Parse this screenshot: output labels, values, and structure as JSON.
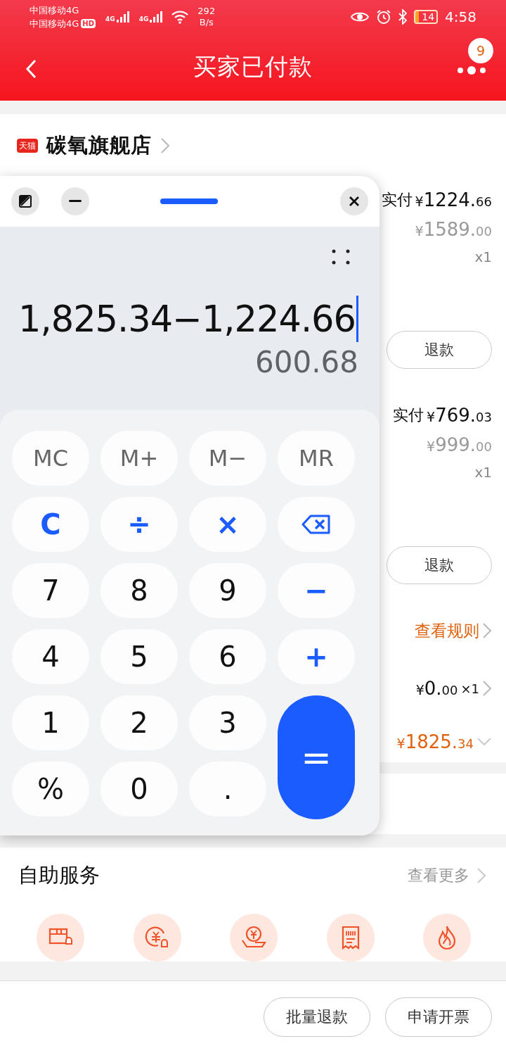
{
  "status_bar": {
    "carrier_1": "中国移动4G",
    "carrier_2": "中国移动4G",
    "hd_badge": "HD",
    "signal_1": "4G",
    "signal_2": "4G",
    "speed_value": "292",
    "speed_unit": "B/s",
    "battery": "14",
    "time": "4:58"
  },
  "header": {
    "title": "买家已付款",
    "badge": "9"
  },
  "store": {
    "badge": "天猫",
    "name": "碳氧旗舰店"
  },
  "items": [
    {
      "paid_label": "实付",
      "paid": {
        "currency": "¥",
        "main": "1224.",
        "fraction": "66"
      },
      "original": {
        "currency": "¥",
        "main": "1589.",
        "fraction": "00"
      },
      "quantity": "x1",
      "button": "退款"
    },
    {
      "paid_label": "实付",
      "paid": {
        "currency": "¥",
        "main": "769.",
        "fraction": "03"
      },
      "original": {
        "currency": "¥",
        "main": "999.",
        "fraction": "00"
      },
      "quantity": "x1",
      "button": "退款"
    }
  ],
  "rules_link": "查看规则",
  "shipping": {
    "currency": "¥",
    "main": "0.",
    "fraction": "00",
    "quantity": "×1"
  },
  "total": {
    "currency": "¥",
    "main": "1825.",
    "fraction": "34"
  },
  "calculator": {
    "expression": "1,825.34−1,224.66",
    "result": "600.68",
    "keys": [
      {
        "kind": "memory",
        "label": "MC"
      },
      {
        "kind": "memory",
        "label": "M+"
      },
      {
        "kind": "memory",
        "label": "M−"
      },
      {
        "kind": "memory",
        "label": "MR"
      },
      {
        "kind": "operator",
        "label": "C"
      },
      {
        "kind": "operator",
        "label": "÷"
      },
      {
        "kind": "operator",
        "label": "×"
      },
      {
        "kind": "backspace"
      },
      {
        "kind": "digit",
        "label": "7"
      },
      {
        "kind": "digit",
        "label": "8"
      },
      {
        "kind": "digit",
        "label": "9"
      },
      {
        "kind": "operator",
        "label": "−"
      },
      {
        "kind": "digit",
        "label": "4"
      },
      {
        "kind": "digit",
        "label": "5"
      },
      {
        "kind": "digit",
        "label": "6"
      },
      {
        "kind": "operator",
        "label": "+"
      },
      {
        "kind": "digit",
        "label": "1"
      },
      {
        "kind": "digit",
        "label": "2"
      },
      {
        "kind": "digit",
        "label": "3"
      },
      {
        "kind": "equals",
        "label": "="
      },
      {
        "kind": "digit",
        "label": "%"
      },
      {
        "kind": "digit",
        "label": "0"
      },
      {
        "kind": "digit",
        "label": "."
      }
    ]
  },
  "self_service": {
    "title": "自助服务",
    "more": "查看更多",
    "services": [
      {
        "kind": "box"
      },
      {
        "kind": "refund"
      },
      {
        "kind": "hand"
      },
      {
        "kind": "receipt"
      },
      {
        "kind": "flame"
      }
    ]
  },
  "bottom_buttons": [
    "批量退款",
    "申请开票"
  ]
}
